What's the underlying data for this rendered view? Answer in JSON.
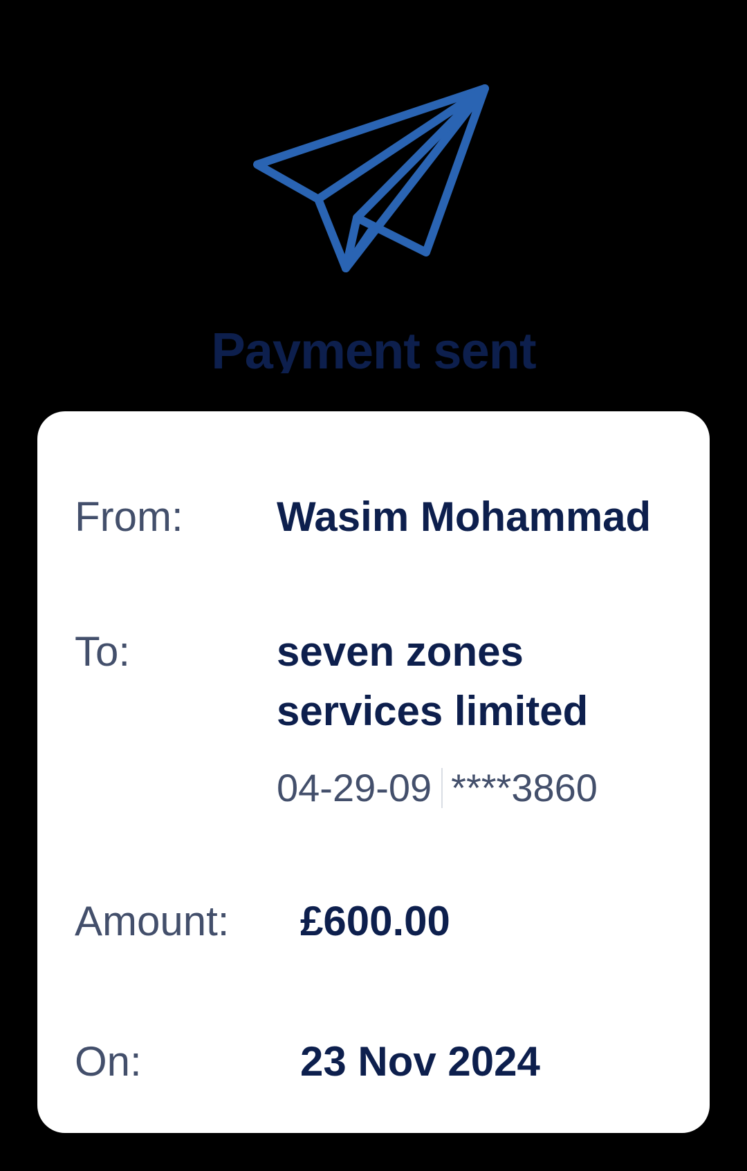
{
  "header": {
    "icon": "paper-plane-icon",
    "title": "Payment sent",
    "icon_color": "#2a64b3",
    "title_color": "#0d1f4d"
  },
  "details": {
    "from_label": "From:",
    "from_value": "Wasim Mohammad",
    "to_label": "To:",
    "to_value": "seven zones services limited",
    "sort_code": "04-29-09",
    "account_number": "****3860",
    "amount_label": "Amount:",
    "amount_value": "£600.00",
    "date_label": "On:",
    "date_value": "23 Nov 2024"
  }
}
